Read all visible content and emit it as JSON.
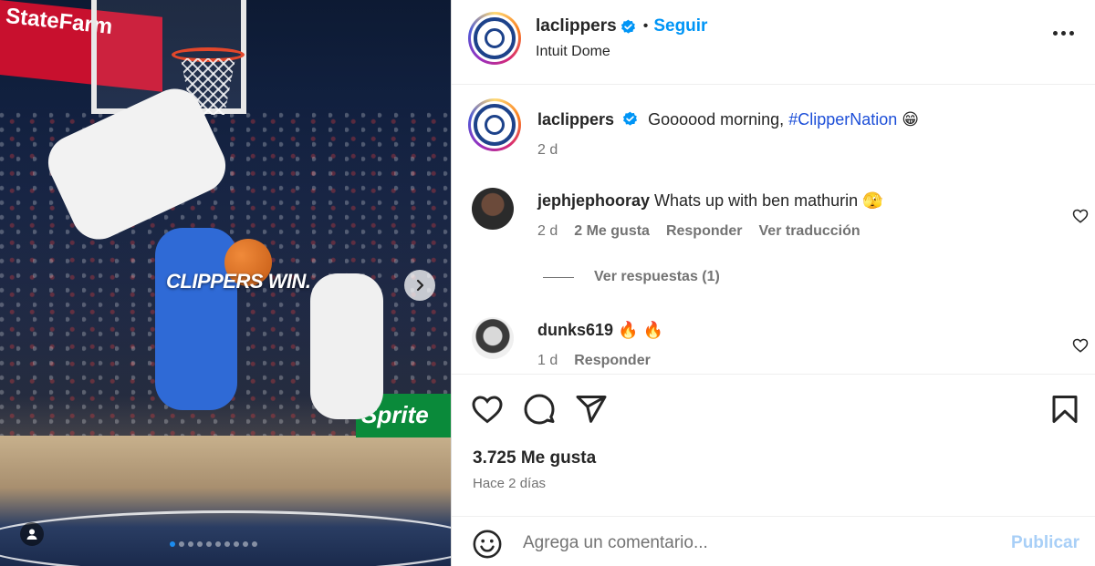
{
  "post": {
    "media": {
      "sponsor_text": "StateFarm",
      "overlay_text": "CLIPPERS WIN.",
      "board_text": "Sprite",
      "slide_count": 10,
      "active_slide": 1
    },
    "header": {
      "username": "laclippers",
      "separator": "•",
      "follow_label": "Seguir",
      "location": "Intuit Dome"
    },
    "caption": {
      "username": "laclippers",
      "text": "Goooood morning, ",
      "hashtag": "#ClipperNation",
      "emoji": "😁",
      "time": "2 d"
    },
    "comments": [
      {
        "username": "jephjephooray",
        "text": "Whats up with ben mathurin",
        "emoji": "🫣",
        "time": "2 d",
        "likes": "2 Me gusta",
        "reply": "Responder",
        "translate": "Ver traducción",
        "replies_label": "Ver respuestas (1)"
      },
      {
        "username": "dunks619",
        "text": "",
        "emoji": "🔥 🔥",
        "time": "1 d",
        "reply": "Responder"
      }
    ],
    "likes_label": "3.725 Me gusta",
    "date_label": "Hace 2 días",
    "composer": {
      "placeholder": "Agrega un comentario...",
      "publish_label": "Publicar"
    },
    "colors": {
      "accent": "#0095f6",
      "verified": "#0095f6",
      "text": "#262626",
      "muted": "#737373",
      "publish_disabled": "#a8cff7"
    },
    "icons": [
      "verified-icon",
      "more-icon",
      "heart-icon",
      "comment-icon",
      "share-icon",
      "bookmark-icon",
      "emoji-icon",
      "chevron-right-icon",
      "user-tag-icon"
    ]
  }
}
